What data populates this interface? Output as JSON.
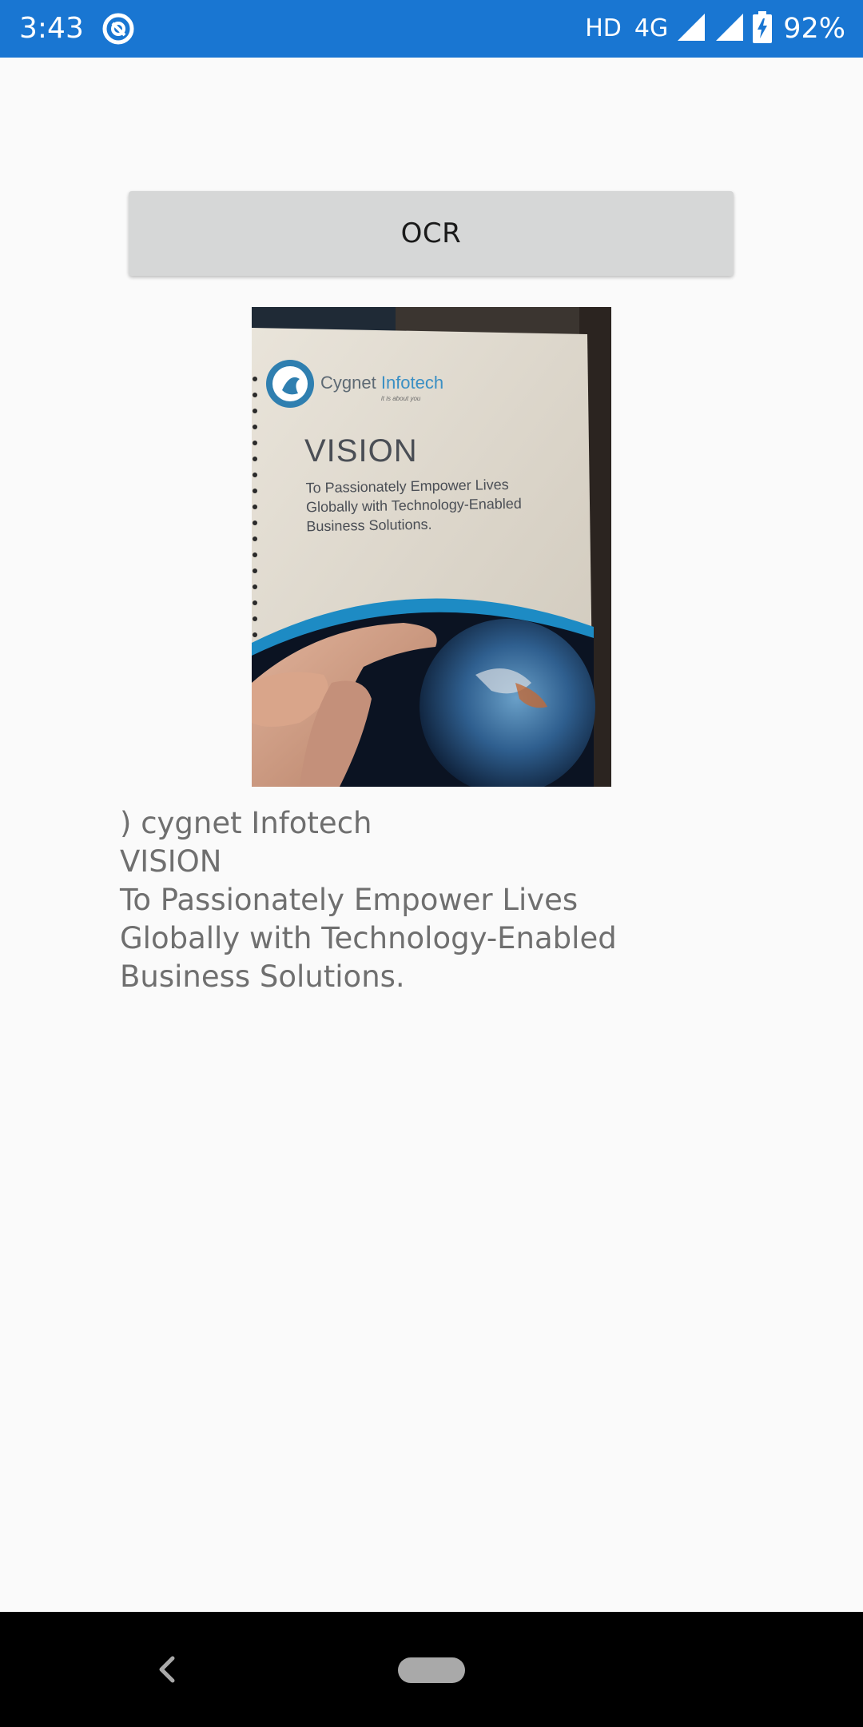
{
  "status_bar": {
    "time": "3:43",
    "network_hd": "HD",
    "network_type": "4G",
    "battery": "92%",
    "color": "#1976d2"
  },
  "main": {
    "ocr_button_label": "OCR",
    "photo": {
      "brand_name": "Cygnet",
      "brand_name_accent": "Infotech",
      "tagline": "it is about you",
      "heading": "VISION",
      "line1": "To Passionately Empower Lives",
      "line2": "Globally with Technology-Enabled",
      "line3": "Business Solutions."
    },
    "ocr_result": [
      ") cygnet Infotech",
      "VISION",
      "To Passionately Empower Lives",
      "Globally with Technology-Enabled",
      "Business Solutions."
    ]
  },
  "nav_bar": {
    "back_icon": "back-chevron-icon",
    "home_icon": "home-pill-icon"
  }
}
